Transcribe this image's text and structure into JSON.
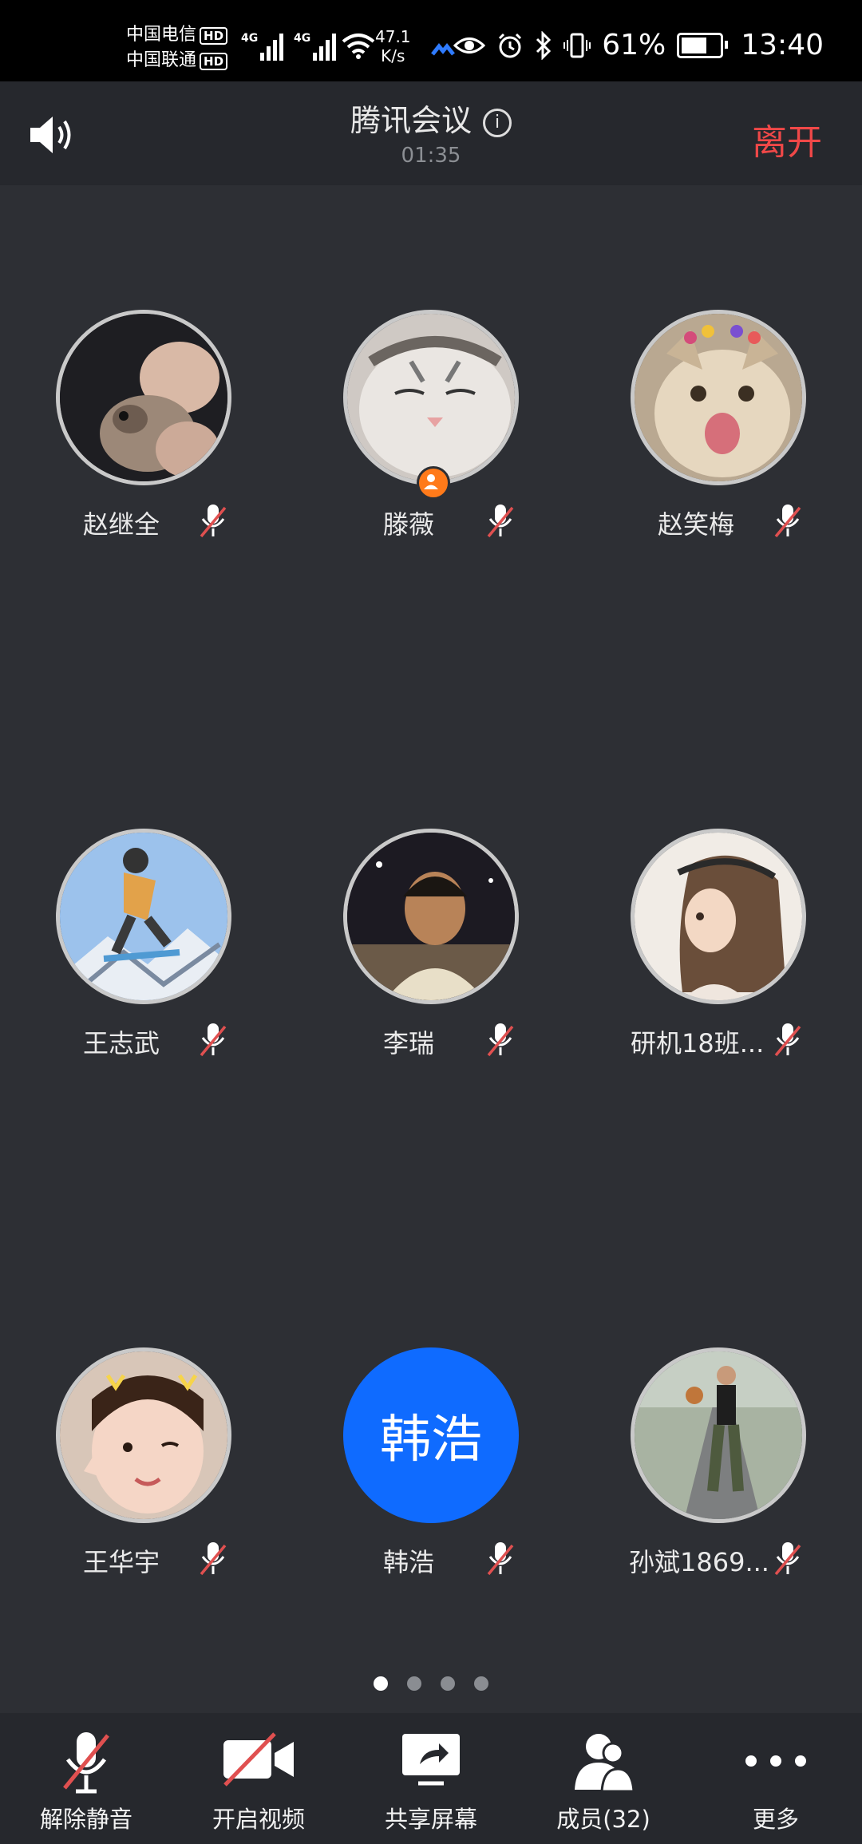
{
  "status_bar": {
    "carrier1": "中国电信",
    "carrier2": "中国联通",
    "hd": "HD",
    "net_type": "4G",
    "speed_value": "47.1",
    "speed_unit": "K/s",
    "battery": "61%",
    "time": "13:40"
  },
  "header": {
    "title": "腾讯会议",
    "timer": "01:35",
    "leave_label": "离开"
  },
  "participants": [
    {
      "name": "赵继全",
      "avatar": "photo-rodent",
      "muted": true
    },
    {
      "name": "滕薇",
      "avatar": "photo-cat-gray",
      "muted": true,
      "host": true
    },
    {
      "name": "赵笑梅",
      "avatar": "photo-cat-flowers",
      "muted": true
    },
    {
      "name": "王志武",
      "avatar": "photo-snowboarder",
      "muted": true
    },
    {
      "name": "李瑞",
      "avatar": "photo-night-portrait",
      "muted": true
    },
    {
      "name": "研机18班...",
      "avatar": "photo-cartoon-girl",
      "muted": true
    },
    {
      "name": "王华宇",
      "avatar": "photo-child",
      "muted": true
    },
    {
      "name": "韩浩",
      "avatar_text": "韩浩",
      "avatar_color": "#0f6bff",
      "muted": true
    },
    {
      "name": "孙斌1869...",
      "avatar": "photo-runner",
      "muted": true
    }
  ],
  "pagination": {
    "total": 4,
    "current": 1
  },
  "toolbar": {
    "unmute": "解除静音",
    "video": "开启视频",
    "share": "共享屏幕",
    "members": "成员(32)",
    "more": "更多"
  },
  "colors": {
    "leave": "#f04848",
    "accent": "#0f6bff",
    "mute_slash": "#e05050",
    "host_badge": "#ff7a1a"
  }
}
